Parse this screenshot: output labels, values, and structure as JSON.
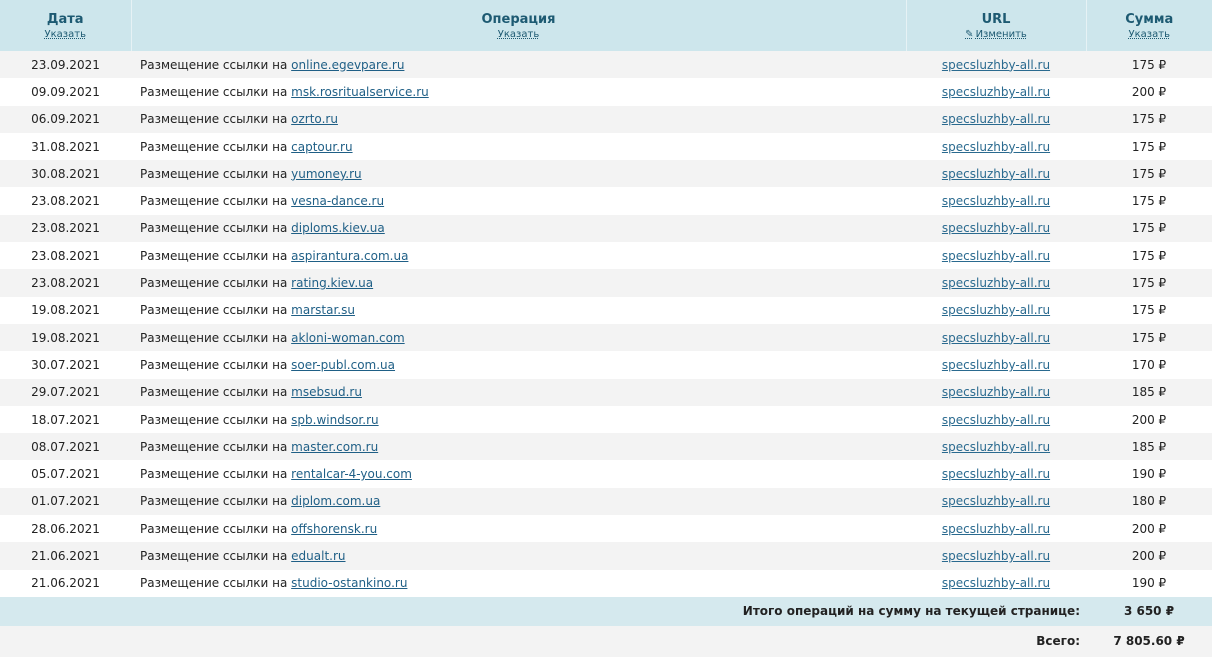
{
  "header": {
    "date": "Дата",
    "date_sort": "Указать",
    "operation": "Операция",
    "operation_sort": "Указать",
    "url": "URL",
    "url_edit": "Изменить",
    "sum": "Сумма",
    "sum_sort": "Указать"
  },
  "op_prefix": "Размещение ссылки на ",
  "currency": "₽",
  "rows": [
    {
      "date": "23.09.2021",
      "site": "online.egevpare.ru",
      "url": "specsluzhby-all.ru",
      "sum": "175 ₽"
    },
    {
      "date": "09.09.2021",
      "site": "msk.rosritualservice.ru",
      "url": "specsluzhby-all.ru",
      "sum": "200 ₽"
    },
    {
      "date": "06.09.2021",
      "site": "ozrto.ru",
      "url": "specsluzhby-all.ru",
      "sum": "175 ₽"
    },
    {
      "date": "31.08.2021",
      "site": "captour.ru",
      "url": "specsluzhby-all.ru",
      "sum": "175 ₽"
    },
    {
      "date": "30.08.2021",
      "site": "yumoney.ru",
      "url": "specsluzhby-all.ru",
      "sum": "175 ₽"
    },
    {
      "date": "23.08.2021",
      "site": "vesna-dance.ru",
      "url": "specsluzhby-all.ru",
      "sum": "175 ₽"
    },
    {
      "date": "23.08.2021",
      "site": "diploms.kiev.ua",
      "url": "specsluzhby-all.ru",
      "sum": "175 ₽"
    },
    {
      "date": "23.08.2021",
      "site": "aspirantura.com.ua",
      "url": "specsluzhby-all.ru",
      "sum": "175 ₽"
    },
    {
      "date": "23.08.2021",
      "site": "rating.kiev.ua",
      "url": "specsluzhby-all.ru",
      "sum": "175 ₽"
    },
    {
      "date": "19.08.2021",
      "site": "marstar.su",
      "url": "specsluzhby-all.ru",
      "sum": "175 ₽"
    },
    {
      "date": "19.08.2021",
      "site": "akloni-woman.com",
      "url": "specsluzhby-all.ru",
      "sum": "175 ₽"
    },
    {
      "date": "30.07.2021",
      "site": "soer-publ.com.ua",
      "url": "specsluzhby-all.ru",
      "sum": "170 ₽"
    },
    {
      "date": "29.07.2021",
      "site": "msebsud.ru",
      "url": "specsluzhby-all.ru",
      "sum": "185 ₽"
    },
    {
      "date": "18.07.2021",
      "site": "spb.windsor.ru",
      "url": "specsluzhby-all.ru",
      "sum": "200 ₽"
    },
    {
      "date": "08.07.2021",
      "site": "master.com.ru",
      "url": "specsluzhby-all.ru",
      "sum": "185 ₽"
    },
    {
      "date": "05.07.2021",
      "site": "rentalcar-4-you.com",
      "url": "specsluzhby-all.ru",
      "sum": "190 ₽"
    },
    {
      "date": "01.07.2021",
      "site": "diplom.com.ua",
      "url": "specsluzhby-all.ru",
      "sum": "180 ₽"
    },
    {
      "date": "28.06.2021",
      "site": "offshorensk.ru",
      "url": "specsluzhby-all.ru",
      "sum": "200 ₽"
    },
    {
      "date": "21.06.2021",
      "site": "edualt.ru",
      "url": "specsluzhby-all.ru",
      "sum": "200 ₽"
    },
    {
      "date": "21.06.2021",
      "site": "studio-ostankino.ru",
      "url": "specsluzhby-all.ru",
      "sum": "190 ₽"
    }
  ],
  "totals": {
    "page_label": "Итого операций на сумму на текущей странице:",
    "page_value": "3 650 ₽",
    "grand_label": "Всего:",
    "grand_value": "7 805.60 ₽"
  },
  "colors": {
    "header_bg": "#cde6ec",
    "header_text": "#1d5a72",
    "link": "#1f5f86",
    "stripe": "#f3f3f3",
    "total_bg": "#d5e9ee"
  },
  "icons": {
    "edit": "pencil-icon"
  }
}
